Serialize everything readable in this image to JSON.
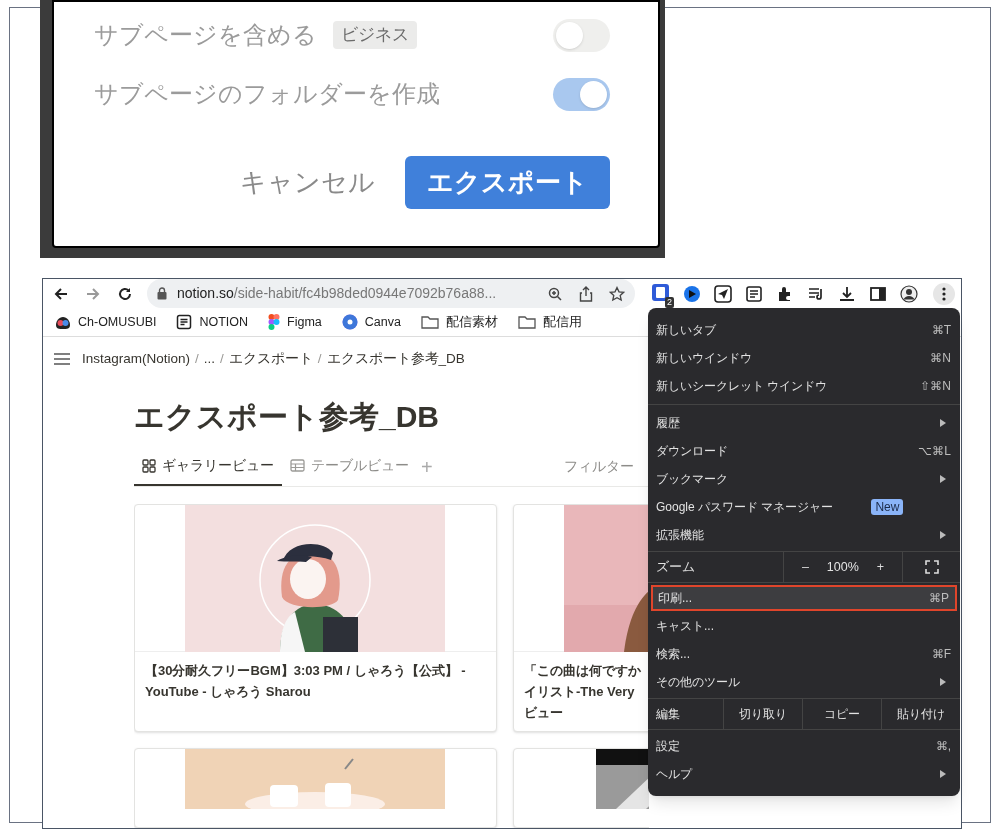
{
  "export_dialog": {
    "options": [
      {
        "label": "サブページを含める",
        "badge": "ビジネス",
        "on": false
      },
      {
        "label": "サブページのフォルダーを作成",
        "on": true
      }
    ],
    "cancel": "キャンセル",
    "export": "エクスポート"
  },
  "browser": {
    "url_host": "notion.so",
    "url_path": "/side-habit/fc4b98ded0944e7092b76a88...",
    "extension_badge": "2",
    "bookmarks": [
      {
        "label": "Ch-OMUSUBI",
        "kind": "site"
      },
      {
        "label": "NOTION",
        "kind": "notion"
      },
      {
        "label": "Figma",
        "kind": "figma"
      },
      {
        "label": "Canva",
        "kind": "canva"
      },
      {
        "label": "配信素材",
        "kind": "folder"
      },
      {
        "label": "配信用",
        "kind": "folder"
      }
    ]
  },
  "page": {
    "breadcrumbs": [
      {
        "label": "Instagram(Notion)"
      },
      {
        "separator": "/",
        "label": "..."
      },
      {
        "separator": "/",
        "label": "エクスポート"
      },
      {
        "separator": "/",
        "label": "エクスポート参考_DB"
      }
    ],
    "title": "エクスポート参考_DB",
    "views": [
      {
        "label": "ギャラリービュー",
        "kind": "gallery",
        "selected": true
      },
      {
        "label": "テーブルビュー",
        "kind": "table",
        "selected": false
      }
    ],
    "add_view": "+",
    "filter": "フィルター",
    "cards": [
      {
        "lines": [
          "【30分耐久フリーBGM】3:03 PM / しゃろう【公式】 - YouTube - しゃろう Sharou"
        ],
        "kind": "girl"
      },
      {
        "lines": [
          "「この曲は何ですか",
          "イリスト-The Very",
          "ビュー"
        ],
        "kind": "pink"
      },
      {
        "kind": "peach"
      },
      {
        "kind": "gray"
      }
    ]
  },
  "menu": [
    {
      "kind": "item",
      "label": "新しいタブ",
      "shortcut": "⌘T",
      "highlighted": false
    },
    {
      "kind": "item",
      "label": "新しいウインドウ",
      "shortcut": "⌘N",
      "highlighted": false
    },
    {
      "kind": "item",
      "label": "新しいシークレット ウインドウ",
      "shortcut": "⇧⌘N",
      "highlighted": false
    },
    {
      "kind": "separator"
    },
    {
      "kind": "item",
      "label": "履歴",
      "submenu": true,
      "highlighted": false
    },
    {
      "kind": "item",
      "label": "ダウンロード",
      "shortcut": "⌥⌘L",
      "highlighted": false
    },
    {
      "kind": "item",
      "label": "ブックマーク",
      "submenu": true,
      "highlighted": false
    },
    {
      "kind": "item",
      "label": "Google パスワード マネージャー",
      "badge": "New",
      "highlighted": false
    },
    {
      "kind": "item",
      "label": "拡張機能",
      "submenu": true,
      "highlighted": false
    },
    {
      "kind": "zoom",
      "label": "ズーム",
      "minus": "–",
      "value": "100%",
      "plus": "+"
    },
    {
      "kind": "item",
      "label": "印刷...",
      "shortcut": "⌘P",
      "highlighted": true
    },
    {
      "kind": "item",
      "label": "キャスト...",
      "highlighted": false
    },
    {
      "kind": "item",
      "label": "検索...",
      "shortcut": "⌘F",
      "highlighted": false
    },
    {
      "kind": "item",
      "label": "その他のツール",
      "submenu": true,
      "highlighted": false
    },
    {
      "kind": "edit",
      "label": "編集",
      "actions": [
        "切り取り",
        "コピー",
        "貼り付け"
      ]
    },
    {
      "kind": "item",
      "label": "設定",
      "shortcut": "⌘,",
      "highlighted": false
    },
    {
      "kind": "item",
      "label": "ヘルプ",
      "submenu": true,
      "highlighted": false
    }
  ]
}
